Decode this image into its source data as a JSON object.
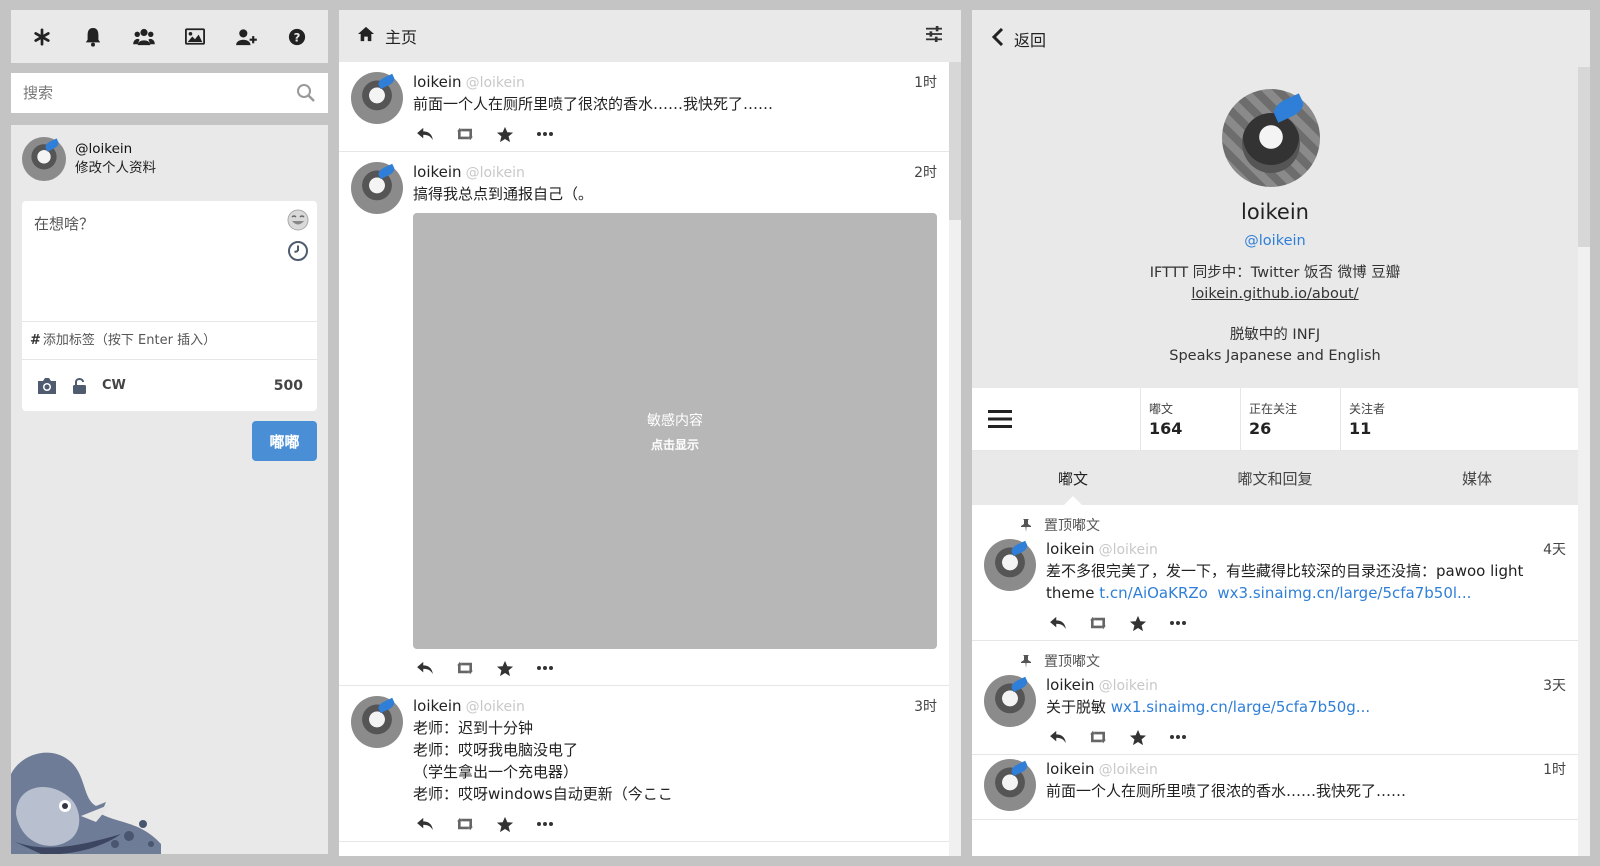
{
  "nav": {
    "icons": [
      "asterisk-icon",
      "bell-icon",
      "users-icon",
      "image-icon",
      "user-plus-icon",
      "help-icon"
    ]
  },
  "search": {
    "placeholder": "搜索"
  },
  "compose": {
    "handle": "@loikein",
    "edit_profile": "修改个人资料",
    "placeholder": "在想啥？",
    "tag_placeholder": "添加标签（按下 Enter 插入）",
    "cw": "CW",
    "count": "500",
    "toot": "嘟嘟"
  },
  "home": {
    "title": "主页",
    "statuses": [
      {
        "name": "loikein",
        "acct": "@loikein",
        "time": "1时",
        "content": "前面一个人在厕所里喷了很浓的香水……我快死了……"
      },
      {
        "name": "loikein",
        "acct": "@loikein",
        "time": "2时",
        "content": "搞得我总点到通报自己（。",
        "sensitive_label": "敏感内容",
        "sensitive_hint": "点击显示"
      },
      {
        "name": "loikein",
        "acct": "@loikein",
        "time": "3时",
        "lines": [
          "老师：迟到十分钟",
          "老师：哎呀我电脑没电了",
          "（学生拿出一个充电器）",
          "老师：哎呀windows自动更新（今ここ"
        ]
      }
    ]
  },
  "profile": {
    "back": "返回",
    "display_name": "loikein",
    "acct": "@loikein",
    "bio_line1": "IFTTT 同步中：Twitter 饭否 微博 豆瓣",
    "bio_link": "loikein.github.io/about/",
    "bio_line3": "脱敏中的 INFJ",
    "bio_line4": "Speaks Japanese and English",
    "stats": [
      {
        "label": "嘟文",
        "value": "164"
      },
      {
        "label": "正在关注",
        "value": "26"
      },
      {
        "label": "关注者",
        "value": "11"
      }
    ],
    "tabs": [
      "嘟文",
      "嘟文和回复",
      "媒体"
    ],
    "pinned_label": "置顶嘟文",
    "statuses": [
      {
        "name": "loikein",
        "acct": "@loikein",
        "time": "4天",
        "text": "差不多很完美了，发一下，有些藏得比较深的目录还没搞：pawoo light theme ",
        "link1": "t.cn/AiOaKRZo",
        "link2": "wx3.sinaimg.cn/large/5cfa7b50l..."
      },
      {
        "name": "loikein",
        "acct": "@loikein",
        "time": "3天",
        "text": "关于脱敏 ",
        "link1": "wx1.sinaimg.cn/large/5cfa7b50g..."
      },
      {
        "name": "loikein",
        "acct": "@loikein",
        "time": "1时",
        "text": "前面一个人在厕所里喷了很浓的香水……我快死了……"
      }
    ]
  }
}
